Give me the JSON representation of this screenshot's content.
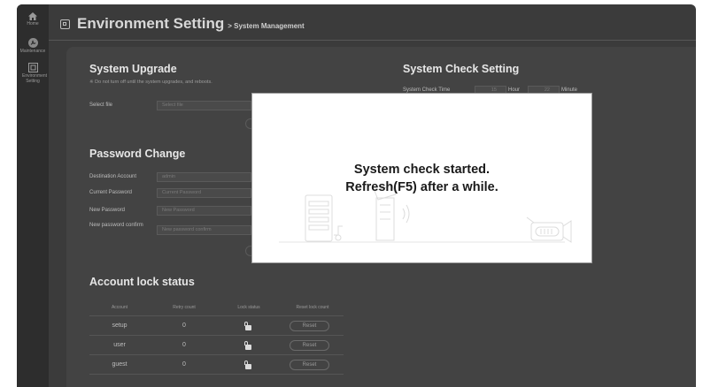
{
  "nav": {
    "items": [
      {
        "label": "Home",
        "icon": "home-icon"
      },
      {
        "label": "Maintenance",
        "icon": "maintenance-icon"
      },
      {
        "label": "Environment Setting",
        "icon": "environment-setting-icon"
      }
    ]
  },
  "header": {
    "title": "Environment Setting",
    "breadcrumb": "> System Management"
  },
  "upgrade": {
    "title": "System Upgrade",
    "note": "※ Do not turn off until the system upgrades, and reboots.",
    "select_label": "Select file",
    "select_placeholder": "Select file"
  },
  "check": {
    "title": "System Check Setting",
    "time_label": "System Check Time",
    "hour_value": "15",
    "hour_label": "Hour",
    "minute_value": "22",
    "minute_label": "Minute"
  },
  "password": {
    "title": "Password Change",
    "dest_label": "Destination Account",
    "dest_value": "admin",
    "current_label": "Current Password",
    "current_placeholder": "Current Password",
    "new_label": "New Password",
    "new_placeholder": "New Password",
    "confirm_label": "New password confirm",
    "confirm_placeholder": "New password confirm"
  },
  "lock": {
    "title": "Account lock status",
    "headers": [
      "Account",
      "Retry count",
      "Lock status",
      "Reset lock count"
    ],
    "rows": [
      {
        "account": "setup",
        "retry": "0",
        "reset": "Reset"
      },
      {
        "account": "user",
        "retry": "0",
        "reset": "Reset"
      },
      {
        "account": "guest",
        "retry": "0",
        "reset": "Reset"
      }
    ]
  },
  "modal": {
    "line1": "System check started.",
    "line2": "Refresh(F5) after a while."
  }
}
